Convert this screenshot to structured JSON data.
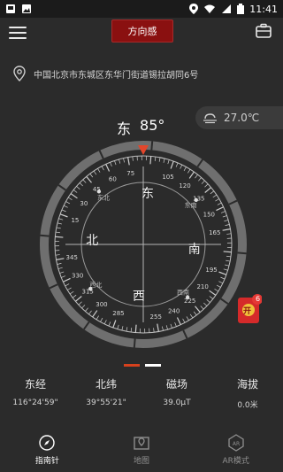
{
  "statusbar": {
    "time": "11:41"
  },
  "toolbar": {
    "title": "方向感"
  },
  "location": {
    "address": "中国北京市东城区东华门街道锡拉胡同6号"
  },
  "weather": {
    "temperature": "27.0℃"
  },
  "heading": {
    "direction": "东",
    "degrees": "85°"
  },
  "compass": {
    "cardinals": {
      "north": "北",
      "east": "东",
      "south": "南",
      "west": "西"
    },
    "intercardinals": {
      "ne": "东北",
      "se": "东南",
      "sw": "西南",
      "nw": "西北"
    },
    "major_ticks": [
      {
        "label": "60",
        "deg": 60
      },
      {
        "label": "75",
        "deg": 75
      },
      {
        "label": "105",
        "deg": 105
      },
      {
        "label": "120",
        "deg": 120
      },
      {
        "label": "135",
        "deg": 135
      },
      {
        "label": "150",
        "deg": 150
      },
      {
        "label": "165",
        "deg": 165
      },
      {
        "label": "195",
        "deg": 195
      },
      {
        "label": "210",
        "deg": 210
      },
      {
        "label": "225",
        "deg": 225
      },
      {
        "label": "240",
        "deg": 240
      },
      {
        "label": "255",
        "deg": 255
      },
      {
        "label": "285",
        "deg": 285
      },
      {
        "label": "300",
        "deg": 300
      },
      {
        "label": "315",
        "deg": 315
      },
      {
        "label": "330",
        "deg": 330
      },
      {
        "label": "345",
        "deg": 345
      },
      {
        "label": "15",
        "deg": 15
      },
      {
        "label": "30",
        "deg": 30
      },
      {
        "label": "45",
        "deg": 45
      }
    ]
  },
  "badge": {
    "count": "6",
    "label": "开"
  },
  "stats": [
    {
      "label": "东经",
      "value": "116°24'59\""
    },
    {
      "label": "北纬",
      "value": "39°55'21\""
    },
    {
      "label": "磁场",
      "value": "39.0μT"
    },
    {
      "label": "海拔",
      "value": "0.0米"
    }
  ],
  "nav": [
    {
      "label": "指南针",
      "icon": "compass-icon"
    },
    {
      "label": "地图",
      "icon": "map-icon"
    },
    {
      "label": "AR模式",
      "icon": "ar-icon"
    }
  ]
}
